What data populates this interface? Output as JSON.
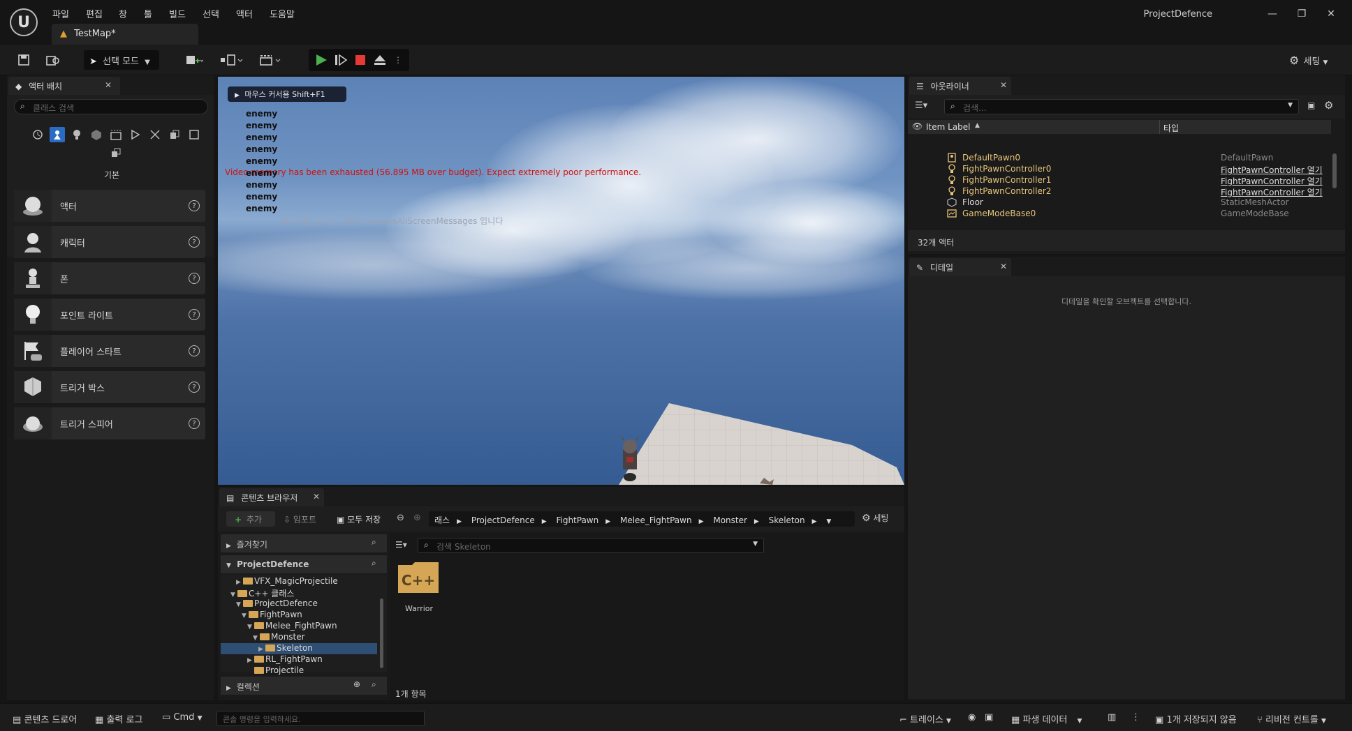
{
  "window": {
    "app_title": "ProjectDefence",
    "doc_tab": "TestMap*",
    "menu": [
      "파일",
      "편집",
      "창",
      "툴",
      "빌드",
      "선택",
      "액터",
      "도움말"
    ]
  },
  "toolbar": {
    "mode_label": "선택 모드",
    "settings_label": "세팅"
  },
  "place_actors": {
    "tab_title": "액터 배치",
    "search_placeholder": "클래스 검색",
    "category": "기본",
    "items": [
      "액터",
      "캐릭터",
      "폰",
      "포인트 라이트",
      "플레이어 스타트",
      "트리거 박스",
      "트리거 스피어"
    ],
    "help_glyph": "?"
  },
  "viewport": {
    "hint_button": "마우스 커서용 Shift+F1",
    "enemy_label": "enemy",
    "enemy_count": 9,
    "warning": "Video memory has been exhausted (56.895 MB over budget). Expect extremely poor performance.",
    "message_hint": "메시지를 숨기는 명령은 DisableAllScreenMessages 입니다"
  },
  "outliner": {
    "tab_title": "아웃라이너",
    "search_placeholder": "검색...",
    "col_label": "Item Label",
    "col_type": "타입",
    "rows": [
      {
        "label": "DefaultPawn0",
        "type": "DefaultPawn",
        "link": false,
        "icon": "pawn-icon"
      },
      {
        "label": "FightPawnController0",
        "type": "FightPawnController 열기",
        "link": true,
        "icon": "controller-icon"
      },
      {
        "label": "FightPawnController1",
        "type": "FightPawnController 열기",
        "link": true,
        "icon": "controller-icon"
      },
      {
        "label": "FightPawnController2",
        "type": "FightPawnController 열기",
        "link": true,
        "icon": "controller-icon"
      },
      {
        "label": "Floor",
        "type": "StaticMeshActor",
        "link": false,
        "icon": "mesh-icon"
      },
      {
        "label": "GameModeBase0",
        "type": "GameModeBase",
        "link": false,
        "icon": "gamemode-icon"
      }
    ],
    "actor_count": "32개 액터"
  },
  "details": {
    "tab_title": "디테일",
    "empty_message": "디테일을 확인할 오브젝트를 선택합니다."
  },
  "content_browser": {
    "tab_title": "콘텐츠 브라우저",
    "add_label": "추가",
    "import_label": "임포트",
    "save_all_label": "모두 저장",
    "settings_label": "세팅",
    "breadcrumb": [
      "래스",
      "ProjectDefence",
      "FightPawn",
      "Melee_FightPawn",
      "Monster",
      "Skeleton"
    ],
    "favorites_label": "즐겨찾기",
    "project_label": "ProjectDefence",
    "tree": [
      {
        "label": "VFX_MagicProjectile",
        "indent": 1,
        "arrow": "▶"
      },
      {
        "label": "C++ 클래스",
        "indent": 0,
        "arrow": "▼"
      },
      {
        "label": "ProjectDefence",
        "indent": 1,
        "arrow": "▼"
      },
      {
        "label": "FightPawn",
        "indent": 2,
        "arrow": "▼"
      },
      {
        "label": "Melee_FightPawn",
        "indent": 3,
        "arrow": "▼"
      },
      {
        "label": "Monster",
        "indent": 4,
        "arrow": "▼"
      },
      {
        "label": "Skeleton",
        "indent": 5,
        "arrow": "▶",
        "selected": true
      },
      {
        "label": "RL_FightPawn",
        "indent": 3,
        "arrow": "▶"
      },
      {
        "label": "Projectile",
        "indent": 3,
        "arrow": ""
      }
    ],
    "collections_label": "컬렉션",
    "asset_search_placeholder": "검색 Skeleton",
    "asset_name": "Warrior",
    "asset_badge": "C++",
    "item_count": "1개 항목"
  },
  "statusbar": {
    "content_drawer": "콘텐츠 드로어",
    "output_log": "출력 로그",
    "cmd": "Cmd",
    "console_placeholder": "콘솔 명령을 입력하세요.",
    "trace": "트레이스",
    "derived_data": "파생 데이터",
    "unsaved": "1개 저장되지 않음",
    "revision": "리비전 컨트롤"
  },
  "colors": {
    "accent_green": "#4caf50",
    "stop_red": "#e53935",
    "folder": "#d4a656",
    "warning_red": "#d01010",
    "outliner_label": "#e8c57a"
  }
}
